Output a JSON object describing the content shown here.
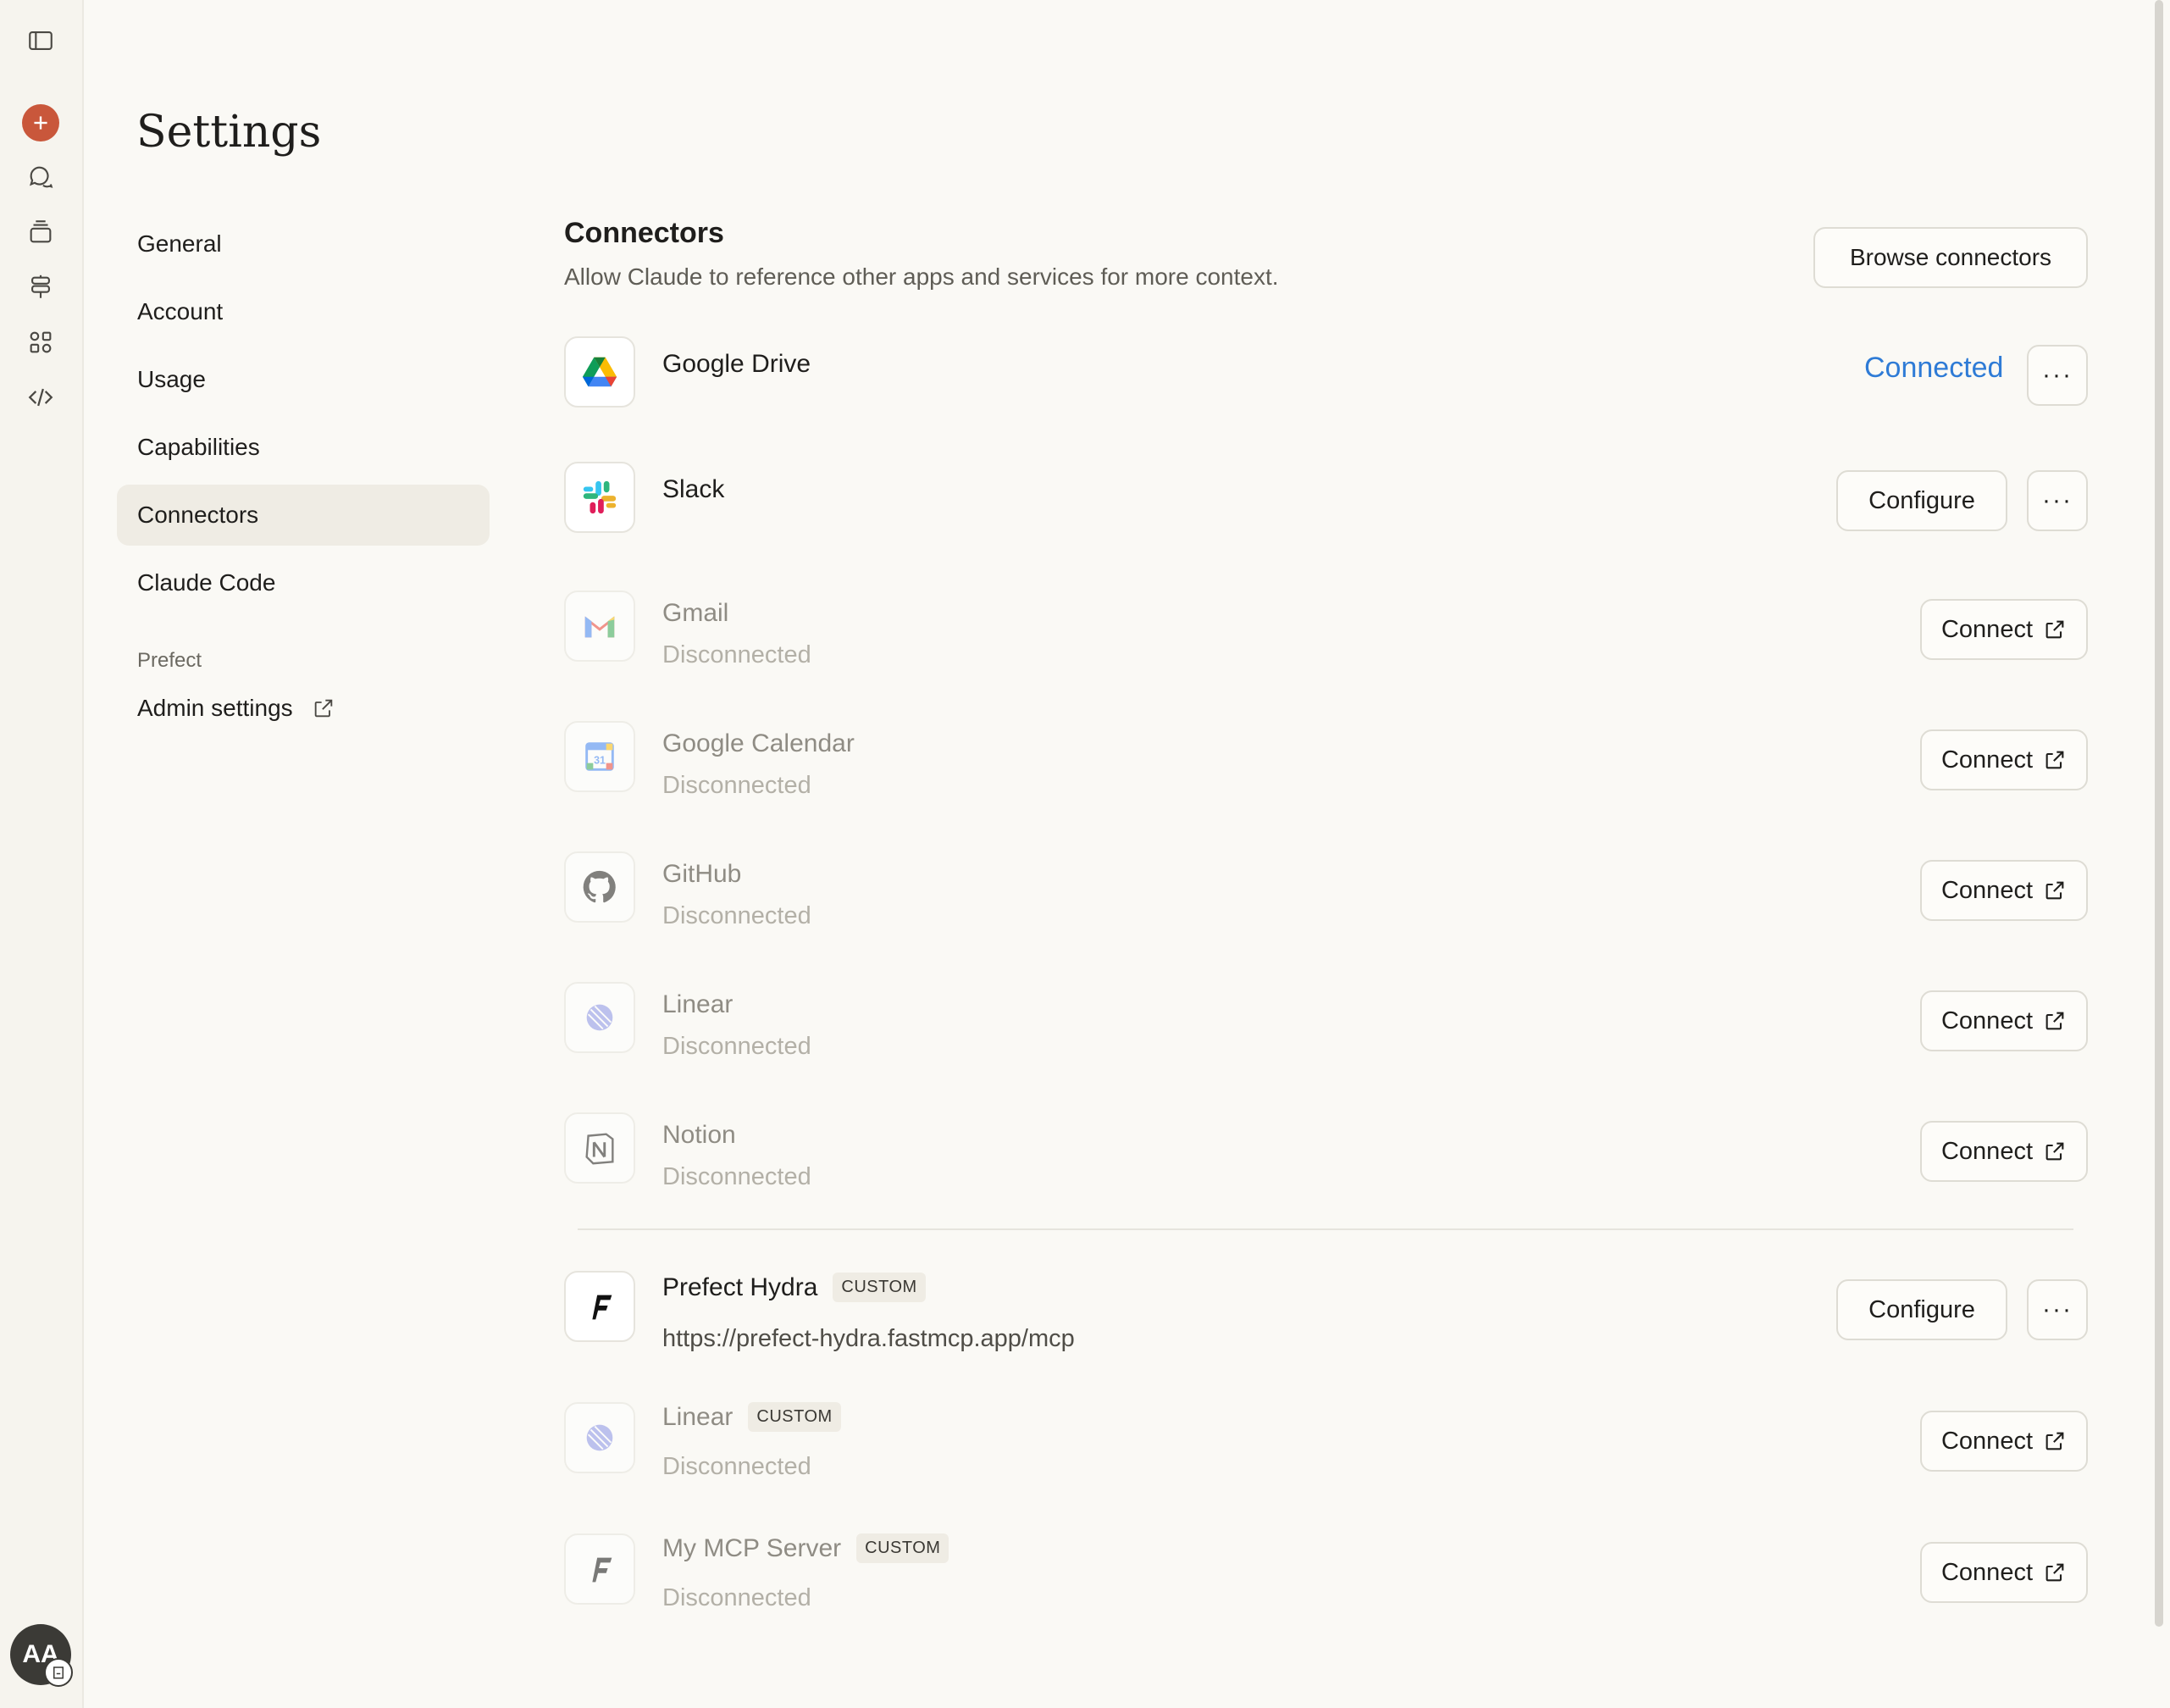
{
  "page_title": "Settings",
  "nav": {
    "items": [
      {
        "label": "General"
      },
      {
        "label": "Account"
      },
      {
        "label": "Usage"
      },
      {
        "label": "Capabilities"
      },
      {
        "label": "Connectors"
      },
      {
        "label": "Claude Code"
      }
    ],
    "active": "Connectors",
    "group_label": "Prefect",
    "admin_label": "Admin settings"
  },
  "connectors": {
    "title": "Connectors",
    "description": "Allow Claude to reference other apps and services for more context.",
    "browse_label": "Browse connectors",
    "connected_label": "Connected",
    "configure_label": "Configure",
    "connect_label": "Connect",
    "more_label": "···",
    "custom_badge": "CUSTOM",
    "disconnected_label": "Disconnected",
    "items": [
      {
        "name": "Google Drive",
        "icon": "google-drive-icon",
        "state": "connected"
      },
      {
        "name": "Slack",
        "icon": "slack-icon",
        "state": "configured"
      },
      {
        "name": "Gmail",
        "icon": "gmail-icon",
        "state": "disconnected",
        "status": "Disconnected"
      },
      {
        "name": "Google Calendar",
        "icon": "google-calendar-icon",
        "state": "disconnected",
        "status": "Disconnected"
      },
      {
        "name": "GitHub",
        "icon": "github-icon",
        "state": "disconnected",
        "status": "Disconnected"
      },
      {
        "name": "Linear",
        "icon": "linear-icon",
        "state": "disconnected",
        "status": "Disconnected"
      },
      {
        "name": "Notion",
        "icon": "notion-icon",
        "state": "disconnected",
        "status": "Disconnected"
      }
    ],
    "custom_items": [
      {
        "name": "Prefect Hydra",
        "badge": "CUSTOM",
        "url": "https://prefect-hydra.fastmcp.app/mcp",
        "state": "configured"
      },
      {
        "name": "Linear",
        "badge": "CUSTOM",
        "status": "Disconnected",
        "state": "disconnected"
      },
      {
        "name": "My MCP Server",
        "badge": "CUSTOM",
        "status": "Disconnected",
        "state": "disconnected"
      }
    ]
  },
  "user": {
    "initials": "AA"
  },
  "colors": {
    "accent": "#c9573b",
    "link": "#2e7bd6",
    "background": "#faf9f5"
  },
  "calendar_day": "31"
}
